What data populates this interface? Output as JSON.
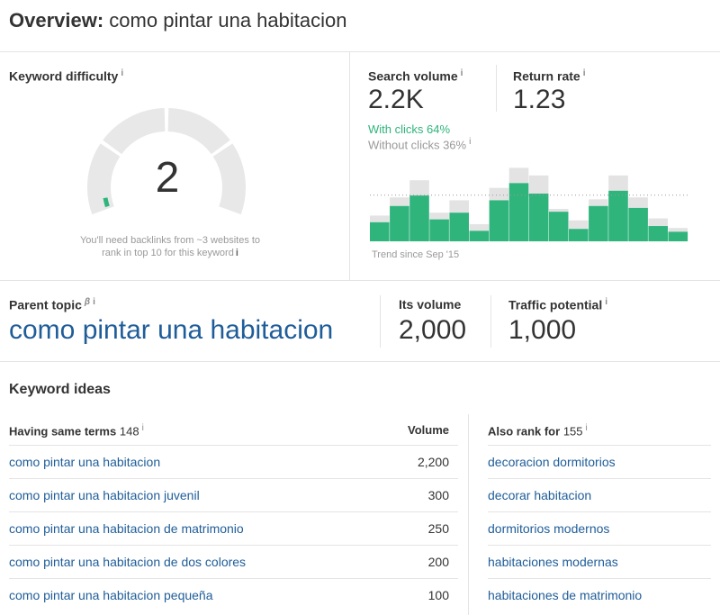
{
  "header": {
    "title_bold": "Overview:",
    "title_keyword": "como pintar una habitacion"
  },
  "keyword_difficulty": {
    "label": "Keyword difficulty",
    "info": "i",
    "value": "2",
    "level": 2,
    "note": "You'll need backlinks from ~3 websites to rank in top 10 for this keyword",
    "accent_color": "#2fb47c",
    "track_color": "#e8e8e8"
  },
  "search_volume": {
    "label": "Search volume",
    "info": "i",
    "value": "2.2K",
    "with_clicks": "With clicks 64%",
    "without_clicks": "Without clicks 36%",
    "trend_note": "Trend since Sep '15"
  },
  "return_rate": {
    "label": "Return rate",
    "info": "i",
    "value": "1.23"
  },
  "chart_data": {
    "type": "bar",
    "series": [
      {
        "name": "With clicks",
        "values": [
          20,
          37,
          48,
          23,
          30,
          11,
          43,
          61,
          50,
          31,
          13,
          37,
          53,
          35,
          16,
          10
        ]
      },
      {
        "name": "Without clicks",
        "values": [
          7,
          9,
          16,
          7,
          13,
          7,
          13,
          16,
          19,
          3,
          9,
          7,
          16,
          11,
          8,
          4
        ]
      }
    ],
    "stacked": true,
    "average_line": "dotted",
    "colors": {
      "with_clicks": "#2fb47c",
      "without_clicks": "#e3e3e3"
    }
  },
  "parent_topic": {
    "label": "Parent topic",
    "beta": "β",
    "info": "i",
    "keyword": "como pintar una habitacion",
    "volume_label": "Its volume",
    "volume": "2,000",
    "traffic_label": "Traffic potential",
    "traffic_info": "i",
    "traffic": "1,000"
  },
  "keyword_ideas": {
    "title": "Keyword ideas",
    "same_terms_label": "Having same terms",
    "same_terms_count": "148",
    "same_terms_info": "i",
    "volume_header": "Volume",
    "same_terms": [
      {
        "keyword": "como pintar una habitacion",
        "volume": "2,200"
      },
      {
        "keyword": "como pintar una habitacion juvenil",
        "volume": "300"
      },
      {
        "keyword": "como pintar una habitacion de matrimonio",
        "volume": "250"
      },
      {
        "keyword": "como pintar una habitacion de dos colores",
        "volume": "200"
      },
      {
        "keyword": "como pintar una habitacion pequeña",
        "volume": "100"
      }
    ],
    "also_rank_label": "Also rank for",
    "also_rank_count": "155",
    "also_rank_info": "i",
    "also_rank": [
      "decoracion dormitorios",
      "decorar habitacion",
      "dormitorios modernos",
      "habitaciones modernas",
      "habitaciones de matrimonio"
    ]
  }
}
